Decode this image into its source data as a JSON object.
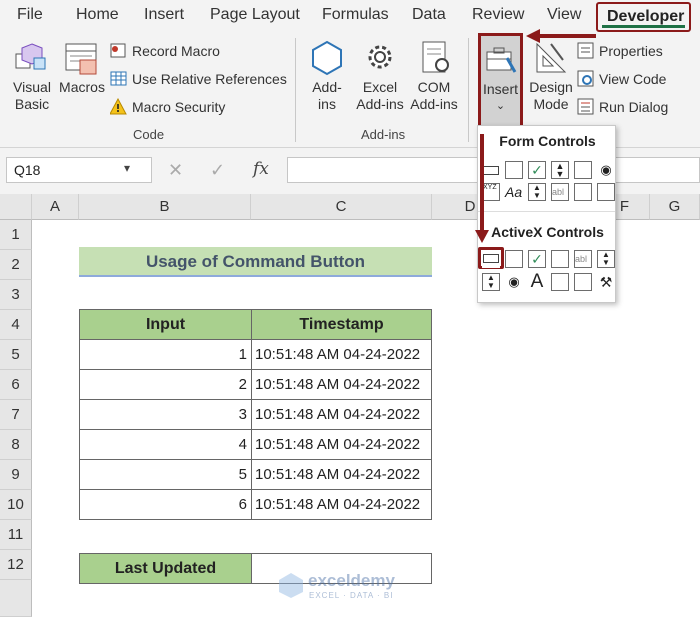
{
  "menu": {
    "tabs": [
      "File",
      "Home",
      "Insert",
      "Page Layout",
      "Formulas",
      "Data",
      "Review",
      "View"
    ],
    "active_tab": "Developer"
  },
  "ribbon": {
    "code": {
      "visual_basic": [
        "Visual",
        "Basic"
      ],
      "macros": "Macros",
      "record_macro": "Record Macro",
      "relative_refs": "Use Relative References",
      "macro_security": "Macro Security",
      "group": "Code"
    },
    "addins": {
      "addins": [
        "Add-",
        "ins"
      ],
      "excel_addins": [
        "Excel",
        "Add-ins"
      ],
      "com_addins": [
        "COM",
        "Add-ins"
      ],
      "group": "Add-ins"
    },
    "controls": {
      "insert": "Insert",
      "design_mode": [
        "Design",
        "Mode"
      ],
      "properties": "Properties",
      "view_code": "View Code",
      "run_dialog": "Run Dialog"
    }
  },
  "insert_dropdown": {
    "form_controls": "Form Controls",
    "activex_controls": "ActiveX Controls"
  },
  "formula_bar": {
    "name_box": "Q18",
    "fx": "fx"
  },
  "columns": [
    "A",
    "B",
    "C",
    "D",
    "F",
    "G"
  ],
  "rows": [
    "1",
    "2",
    "3",
    "4",
    "5",
    "6",
    "7",
    "8",
    "9",
    "10",
    "11",
    "12"
  ],
  "sheet": {
    "title": "Usage of Command Button",
    "headers": [
      "Input",
      "Timestamp"
    ],
    "data": [
      {
        "input": "1",
        "timestamp": "10:51:48 AM 04-24-2022"
      },
      {
        "input": "2",
        "timestamp": "10:51:48 AM 04-24-2022"
      },
      {
        "input": "3",
        "timestamp": "10:51:48 AM 04-24-2022"
      },
      {
        "input": "4",
        "timestamp": "10:51:48 AM 04-24-2022"
      },
      {
        "input": "5",
        "timestamp": "10:51:48 AM 04-24-2022"
      },
      {
        "input": "6",
        "timestamp": "10:51:48 AM 04-24-2022"
      }
    ],
    "last_updated_label": "Last Updated",
    "last_updated_value": ""
  },
  "watermark": {
    "name": "exceldemy",
    "tagline": "EXCEL · DATA · BI"
  },
  "colors": {
    "header_green": "#a9d08e",
    "title_fill": "#c6e0b4",
    "highlight": "#8b1a1a",
    "dev_underline": "#1e7145"
  }
}
